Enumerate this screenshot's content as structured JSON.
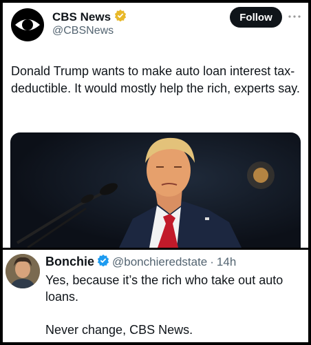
{
  "post": {
    "author_name": "CBS News",
    "author_handle": "@CBSNews",
    "follow_label": "Follow",
    "text": "Donald Trump wants to make auto loan interest tax-deductible. It would mostly help the rich, experts say."
  },
  "reply": {
    "author_name": "Bonchie",
    "author_handle": "@bonchieredstate",
    "separator": "·",
    "time": "14h",
    "line1": "Yes, because it’s the rich who take out auto loans.",
    "line2": "Never change, CBS News."
  },
  "colors": {
    "verified_gold": "#e8b829",
    "verified_blue": "#1d9bf0",
    "text_primary": "#0f1419",
    "text_secondary": "#536471"
  },
  "icons": [
    "cbs-eye-logo-icon",
    "verified-gold-badge-icon",
    "more-icon",
    "verified-blue-badge-icon"
  ]
}
